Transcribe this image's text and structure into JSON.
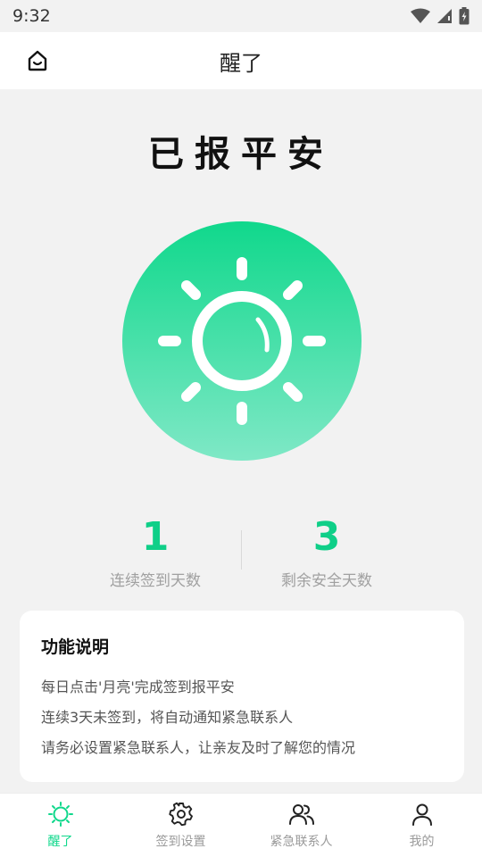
{
  "status": {
    "time": "9:32"
  },
  "appbar": {
    "title": "醒了"
  },
  "headline": "已报平安",
  "stats": [
    {
      "value": "1",
      "label": "连续签到天数"
    },
    {
      "value": "3",
      "label": "剩余安全天数"
    }
  ],
  "card": {
    "title": "功能说明",
    "lines": [
      "每日点击'月亮'完成签到报平安",
      "连续3天未签到，将自动通知紧急联系人",
      "请务必设置紧急联系人，让亲友及时了解您的情况"
    ]
  },
  "nav": [
    {
      "label": "醒了",
      "icon": "sun-icon",
      "active": true
    },
    {
      "label": "签到设置",
      "icon": "gear-icon",
      "active": false
    },
    {
      "label": "紧急联系人",
      "icon": "contacts-icon",
      "active": false
    },
    {
      "label": "我的",
      "icon": "person-icon",
      "active": false
    }
  ],
  "colors": {
    "accent": "#10d88c",
    "background": "#f2f2f2"
  }
}
